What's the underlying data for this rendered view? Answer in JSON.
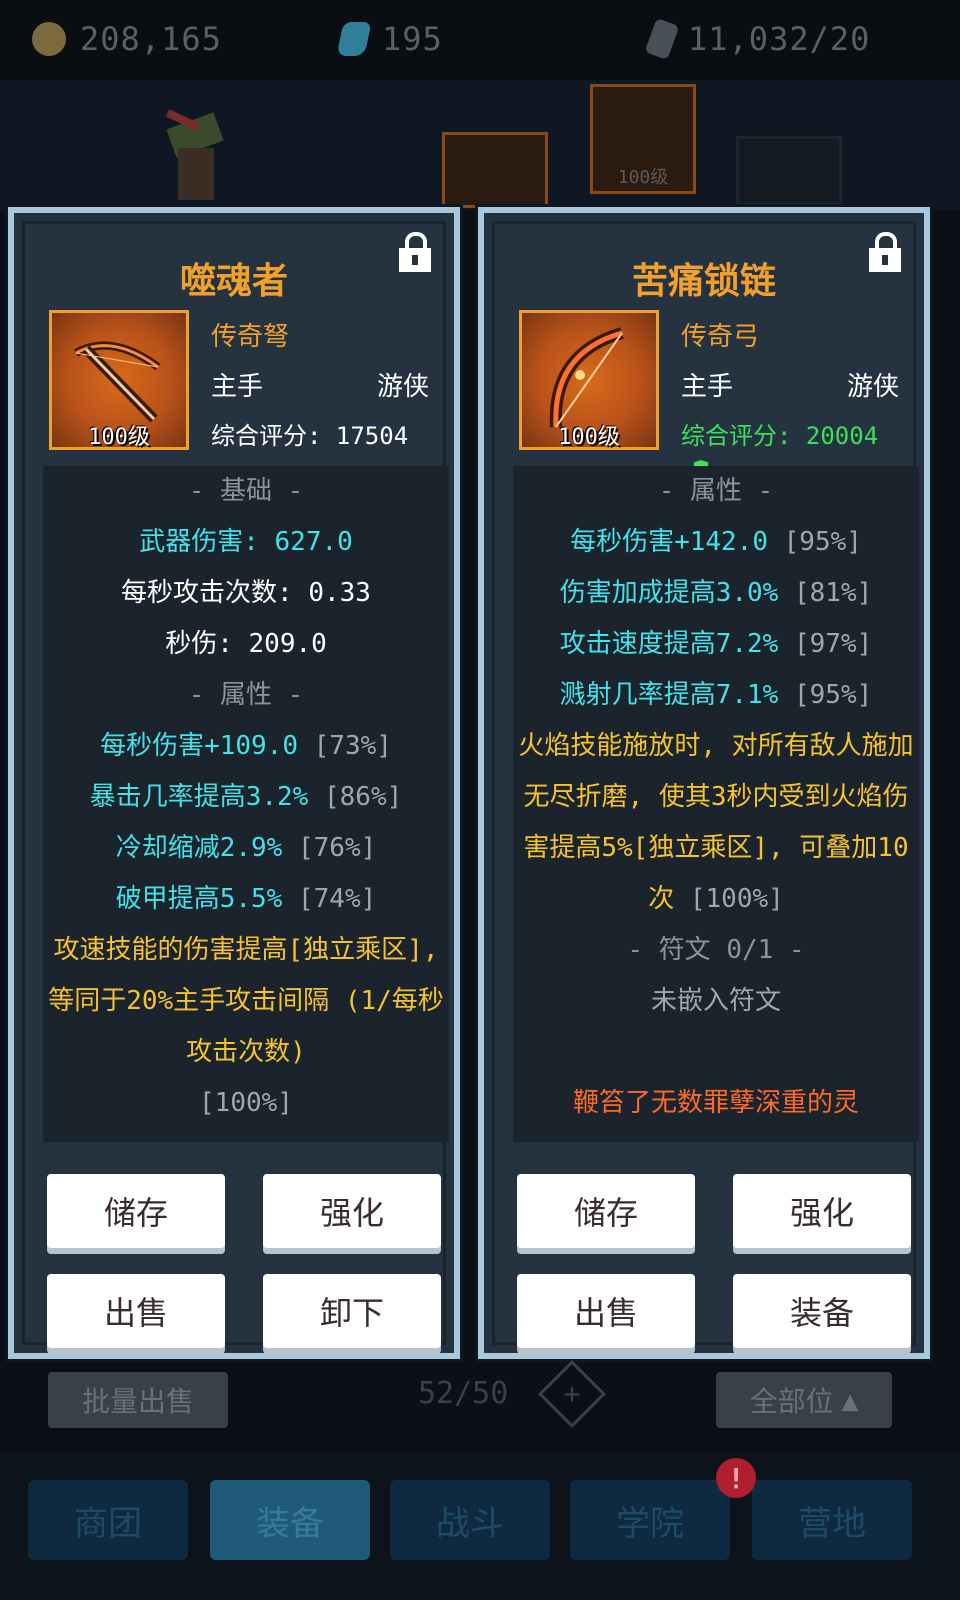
{
  "topbar": {
    "gold": "208,165",
    "gems": "195",
    "shards": "11,032/20"
  },
  "background": {
    "equip_level_label": "100级"
  },
  "left_item": {
    "name": "噬魂者",
    "rarity": "传奇弩",
    "slot": "主手",
    "class": "游侠",
    "level": "100级",
    "score": "综合评分: 17504",
    "sections": {
      "basic_header": "- 基础 -",
      "weapon_damage": "武器伤害: 627.0",
      "attacks_per_sec": "每秒攻击次数: 0.33",
      "dps": "秒伤: 209.0",
      "attr_header": "- 属性 -"
    },
    "attributes": [
      {
        "text": "每秒伤害+109.0",
        "pct": "[73%]"
      },
      {
        "text": "暴击几率提高3.2%",
        "pct": "[86%]"
      },
      {
        "text": "冷却缩减2.9%",
        "pct": "[76%]"
      },
      {
        "text": "破甲提高5.5%",
        "pct": "[74%]"
      }
    ],
    "legendary": "攻速技能的伤害提高[独立乘区], 等同于20%主手攻击间隔 (1/每秒攻击次数)",
    "legendary_pct": "[100%]",
    "buttons": {
      "store": "储存",
      "enhance": "强化",
      "sell": "出售",
      "unequip": "卸下"
    }
  },
  "right_item": {
    "name": "苦痛锁链",
    "rarity": "传奇弓",
    "slot": "主手",
    "class": "游侠",
    "level": "100级",
    "score": "综合评分: 20004",
    "sections": {
      "attr_header": "- 属性 -",
      "rune_header": "- 符文 0/1 -",
      "rune_empty": "未嵌入符文",
      "flavor": "鞭笞了无数罪孽深重的灵"
    },
    "attributes": [
      {
        "text": "每秒伤害+142.0",
        "pct": "[95%]"
      },
      {
        "text": "伤害加成提高3.0%",
        "pct": "[81%]"
      },
      {
        "text": "攻击速度提高7.2%",
        "pct": "[97%]"
      },
      {
        "text": "溅射几率提高7.1%",
        "pct": "[95%]"
      }
    ],
    "legendary": "火焰技能施放时, 对所有敌人施加无尽折磨, 使其3秒内受到火焰伤害提高5%[独立乘区], 可叠加10次",
    "legendary_pct": "[100%]",
    "buttons": {
      "store": "储存",
      "enhance": "强化",
      "sell": "出售",
      "equip": "装备"
    }
  },
  "inventory": {
    "bulk_sell": "批量出售",
    "capacity": "52/50",
    "all_slots": "全部位"
  },
  "tabs": [
    "商团",
    "装备",
    "战斗",
    "学院",
    "营地"
  ],
  "badge": "!"
}
